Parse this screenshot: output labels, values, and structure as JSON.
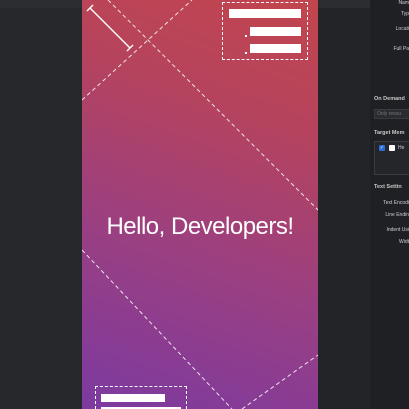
{
  "preview": {
    "headline": "Hello, Developers!"
  },
  "inspector": {
    "rows": [
      {
        "label": "Nam"
      },
      {
        "label": "Typ"
      },
      {
        "label": "Locati"
      },
      {
        "label": "Full Pa"
      }
    ],
    "on_demand": {
      "title": "On Demand",
      "placeholder": "Only resou"
    },
    "target": {
      "title": "Target Mem",
      "item_label": "He"
    },
    "text_settings": {
      "title": "Text Settin",
      "rows": [
        {
          "label": "Text Encodi"
        },
        {
          "label": "Line Endin"
        },
        {
          "label": "Indent Usi"
        },
        {
          "label": "Widt"
        }
      ]
    }
  },
  "colors": {
    "gradient_top": "#c2454d",
    "gradient_bottom": "#7c3aa0",
    "accent_checkbox": "#2a6bd8"
  }
}
